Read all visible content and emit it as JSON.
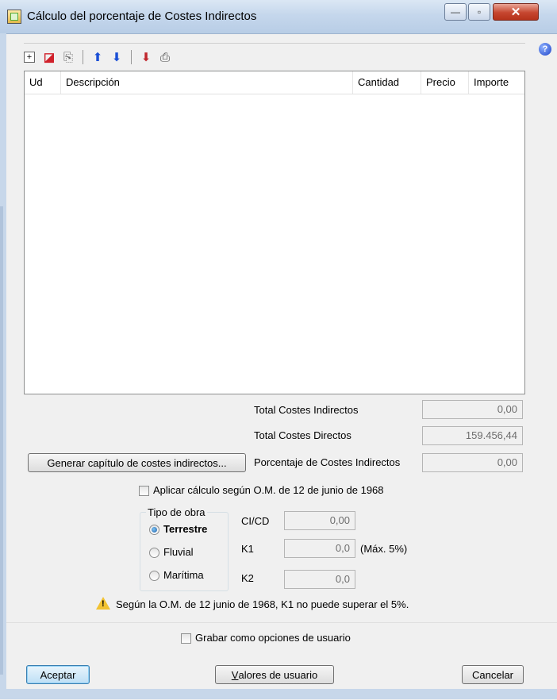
{
  "window": {
    "title": "Cálculo del porcentaje de Costes Indirectos",
    "minimize_glyph": "—",
    "maximize_glyph": "▫",
    "close_glyph": "✕",
    "help_glyph": "?"
  },
  "toolbar": {
    "icons": [
      "add-row-icon",
      "delete-row-icon",
      "copy-icon",
      "move-up-icon",
      "move-down-icon",
      "import-icon",
      "print-icon"
    ],
    "glyphs": {
      "add": "+",
      "delete": "◪",
      "copy": "⎘",
      "up": "⬆",
      "down": "⬇",
      "import": "⬇",
      "print": "⎙"
    }
  },
  "table": {
    "columns": [
      "Ud",
      "Descripción",
      "Cantidad",
      "Precio",
      "Importe"
    ],
    "rows": []
  },
  "totals": {
    "indirect_label": "Total Costes Indirectos",
    "indirect_value": "0,00",
    "direct_label": "Total Costes Directos",
    "direct_value": "159.456,44",
    "percentage_label": "Porcentaje de Costes Indirectos",
    "percentage_value": "0,00"
  },
  "generate_button": "Generar capítulo de costes indirectos...",
  "apply_checkbox": {
    "label": "Aplicar cálculo según O.M. de 12 de junio de 1968",
    "checked": false
  },
  "tipo_obra": {
    "legend": "Tipo de obra",
    "options": [
      {
        "label": "Terrestre",
        "selected": true
      },
      {
        "label": "Fluvial",
        "selected": false
      },
      {
        "label": "Marítima",
        "selected": false
      }
    ]
  },
  "coefficients": {
    "cicd_label": "CI/CD",
    "cicd_value": "0,00",
    "k1_label": "K1",
    "k1_value": "0,0",
    "k1_note": "(Máx. 5%)",
    "k2_label": "K2",
    "k2_value": "0,0"
  },
  "warning": {
    "text": "Según la O.M. de 12 junio de 1968, K1 no puede superar el 5%.",
    "icon": "warning-icon"
  },
  "save_checkbox": {
    "label": "Grabar como opciones de usuario",
    "checked": false
  },
  "buttons": {
    "accept": "Aceptar",
    "user_values_accel": "V",
    "user_values_rest": "alores de usuario",
    "cancel": "Cancelar"
  },
  "colors": {
    "titlebar": "#c5d7ec",
    "close": "#c6462f",
    "accent": "#3c7fb1",
    "warning": "#f1c232"
  }
}
